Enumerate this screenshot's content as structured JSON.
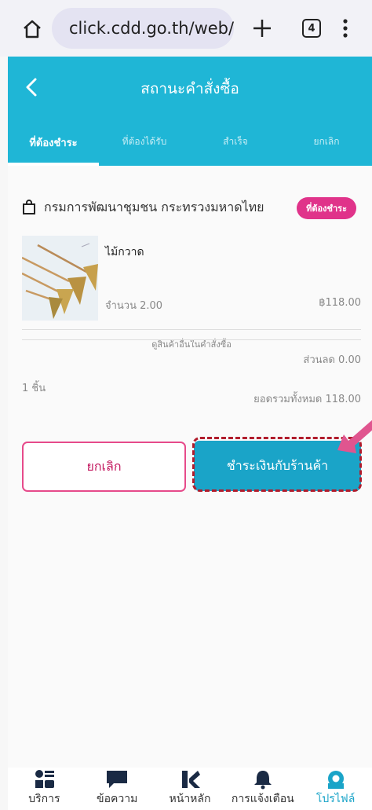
{
  "browser": {
    "url": "click.cdd.go.th/web/",
    "tab_count": "4"
  },
  "header": {
    "title": "สถานะคำสั่งซื้อ"
  },
  "tabs": [
    {
      "label": "ที่ต้องชำระ",
      "active": true
    },
    {
      "label": "ที่ต้องได้รับ",
      "active": false
    },
    {
      "label": "สำเร็จ",
      "active": false
    },
    {
      "label": "ยกเลิก",
      "active": false
    }
  ],
  "order": {
    "shop_name": "กรมการพัฒนาชุมชน กระทรวงมหาดไทย",
    "status_badge": "ที่ต้องชำระ",
    "product": {
      "name": "ไม้กวาด",
      "quantity": "จำนวน 2.00",
      "price": "฿118.00"
    },
    "more_items_link": "ดูสินค้าอื่นในคำสั่งซื้อ",
    "pieces": "1 ชิ้น",
    "discount": "ส่วนลด 0.00",
    "total": "ยอดรวมทั้งหมด 118.00",
    "cancel_label": "ยกเลิก",
    "pay_label": "ชำระเงินกับร้านค้า"
  },
  "colors": {
    "primary": "#1fb6d6",
    "button": "#1aa4c8",
    "accent_pink": "#e0338a",
    "highlight": "#b01c2c"
  },
  "bottom_nav": [
    {
      "label": "บริการ",
      "icon": "grid-icon",
      "active": false
    },
    {
      "label": "ข้อความ",
      "icon": "chat-icon",
      "active": false
    },
    {
      "label": "หน้าหลัก",
      "icon": "home-logo-icon",
      "active": false
    },
    {
      "label": "การแจ้งเตือน",
      "icon": "bell-icon",
      "active": false
    },
    {
      "label": "โปรไฟล์",
      "icon": "profile-icon",
      "active": true
    }
  ]
}
